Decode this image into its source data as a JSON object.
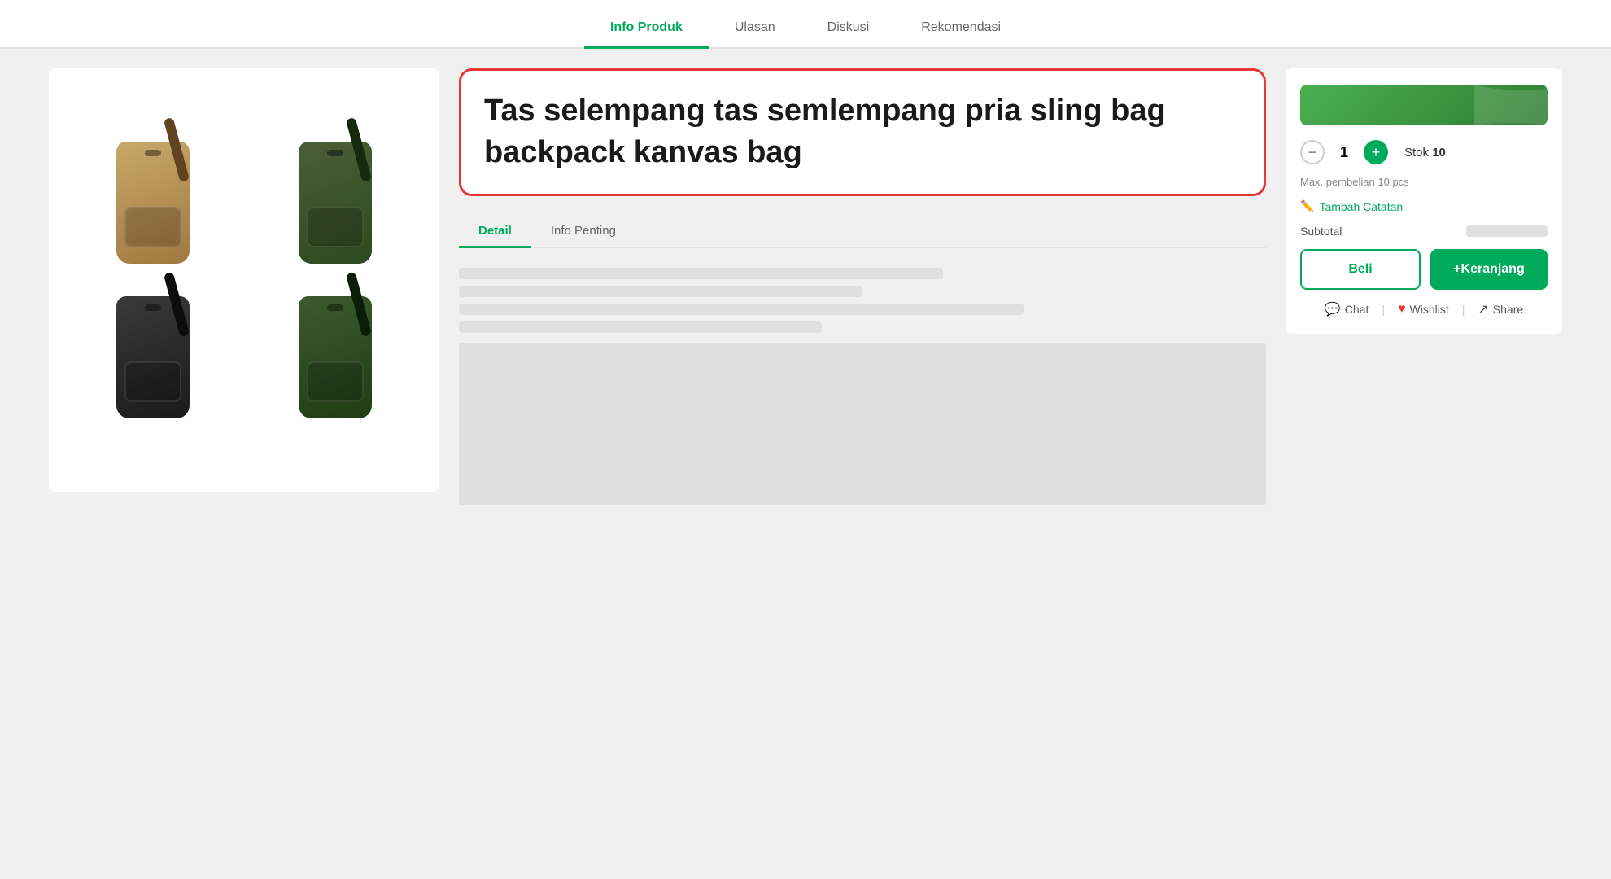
{
  "tabs": {
    "items": [
      {
        "label": "Info Produk",
        "active": true
      },
      {
        "label": "Ulasan",
        "active": false
      },
      {
        "label": "Diskusi",
        "active": false
      },
      {
        "label": "Rekomendasi",
        "active": false
      }
    ]
  },
  "product": {
    "title": "Tas selempang tas semlempang pria sling bag backpack kanvas bag",
    "quantity": "1",
    "stock_label": "Stok",
    "stock_value": "10",
    "max_purchase": "Max. pembelian 10 pcs",
    "tambah_catatan": "Tambah Catatan",
    "subtotal_label": "Subtotal"
  },
  "detail_tabs": {
    "items": [
      {
        "label": "Detail",
        "active": true
      },
      {
        "label": "Info Penting",
        "active": false
      }
    ]
  },
  "buttons": {
    "beli": "Beli",
    "keranjang": "+Keranjang",
    "chat": "Chat",
    "wishlist": "Wishlist",
    "share": "Share"
  },
  "colors": {
    "green": "#00aa5b",
    "red": "#e53935"
  }
}
